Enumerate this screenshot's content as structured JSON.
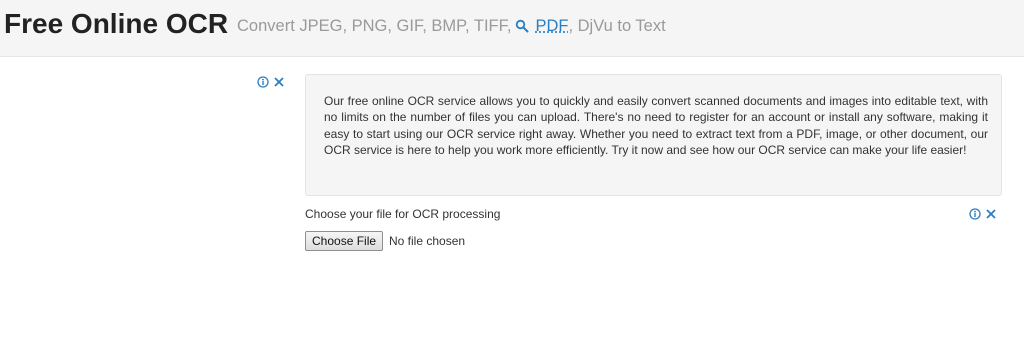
{
  "header": {
    "title": "Free Online OCR",
    "subtitle_before": "Convert JPEG, PNG, GIF, BMP, TIFF,",
    "pdf_link": "PDF",
    "subtitle_after": ", DjVu to Text",
    "search_icon": "search-icon"
  },
  "ads": {
    "info_icon": "info-icon",
    "close_icon": "close-icon",
    "accent_color": "#2a7fc4"
  },
  "description": {
    "text": "Our free online OCR service allows you to quickly and easily convert scanned documents and images into editable text, with no limits on the number of files you can upload. There's no need to register for an account or install any software, making it easy to start using our OCR service right away. Whether you need to extract text from a PDF, image, or other document, our OCR service is here to help you work more efficiently. Try it now and see how our OCR service can make your life easier!"
  },
  "upload": {
    "label": "Choose your file for OCR processing",
    "button_label": "Choose File",
    "status": "No file chosen"
  }
}
